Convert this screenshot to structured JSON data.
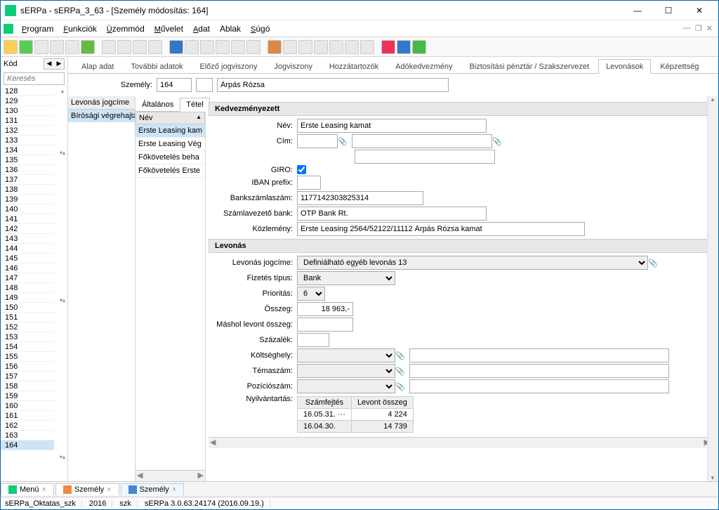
{
  "window": {
    "title": "sERPa - sERPa_3_63 - [Személy módosítás: 164]"
  },
  "menu": {
    "program": "Program",
    "funkciok": "Funkciók",
    "uzemmod": "Üzemmód",
    "muvelet": "Művelet",
    "adat": "Adat",
    "ablak": "Ablak",
    "sugo": "Súgó"
  },
  "sidebar": {
    "kod_label": "Kód",
    "search_ph": "Keresés",
    "rows": [
      "128",
      "129",
      "130",
      "131",
      "132",
      "133",
      "134",
      "135",
      "136",
      "137",
      "138",
      "139",
      "140",
      "141",
      "142",
      "143",
      "144",
      "145",
      "146",
      "147",
      "148",
      "149",
      "150",
      "151",
      "152",
      "153",
      "154",
      "155",
      "156",
      "157",
      "158",
      "159",
      "160",
      "161",
      "162",
      "163",
      "164"
    ],
    "selected": "164"
  },
  "tabs": {
    "items": [
      "Alap adat",
      "További adatok",
      "Előző jogviszony",
      "Jogviszony",
      "Hozzátartozók",
      "Adókedvezmény",
      "Biztosítási pénztár / Szakszervezet",
      "Levonások",
      "Képzettség"
    ],
    "active": 7
  },
  "person_row": {
    "label": "Személy:",
    "code": "164",
    "name": "Árpás Rózsa"
  },
  "narrow": {
    "head": "Levonás jogcíme",
    "cell": "Bírósági végrehajtás"
  },
  "mid": {
    "tabs": [
      "Általános",
      "Tétel"
    ],
    "active": 1,
    "head": "Név",
    "rows": [
      "Erste Leasing kam",
      "Erste Leasing Vég",
      "Főkövetelés beha",
      "Főkövetelés Erste"
    ],
    "selected": 0
  },
  "form": {
    "group1": "Kedvezményezett",
    "nev_lbl": "Név:",
    "nev_val": "Erste Leasing kamat",
    "cim_lbl": "Cím:",
    "giro_lbl": "GIRO:",
    "giro_checked": true,
    "iban_lbl": "IBAN prefix:",
    "bank_lbl": "Bankszámlaszám:",
    "bank_val": "1177142303825314",
    "szaml_lbl": "Számlavezető bank:",
    "szaml_val": "OTP Bank Rt.",
    "kozl_lbl": "Közlemény:",
    "kozl_val": "Erste Leasing 2564/52122/11112 Árpás Rózsa kamat",
    "group2": "Levonás",
    "jogc_lbl": "Levonás jogcíme:",
    "jogc_val": "Definiálható egyéb levonás 13",
    "fiz_lbl": "Fizetés típus:",
    "fiz_val": "Bank",
    "prio_lbl": "Prioritás:",
    "prio_val": "6",
    "ossz_lbl": "Összeg:",
    "ossz_val": "18 963,-",
    "mashol_lbl": "Máshol levont összeg:",
    "szaz_lbl": "Százalék:",
    "kolt_lbl": "Költséghely:",
    "tema_lbl": "Témaszám:",
    "poz_lbl": "Pozíciószám:",
    "nyilv_lbl": "Nyilvántartás:",
    "tbl_h1": "Számfejtés",
    "tbl_h2": "Levont összeg",
    "tbl_r1c1": "16.05.31.",
    "tbl_r1c1b": "···",
    "tbl_r1c2": "4 224",
    "tbl_r2c1": "16.04.30.",
    "tbl_r2c2": "14 739"
  },
  "bottom": {
    "t1": "Menü",
    "t2": "Személy",
    "t3": "Személy"
  },
  "status": {
    "s1": "sERPa_Oktatas_szk",
    "s2": "2016",
    "s3": "szk",
    "s4": "sERPa 3.0.63.24174 (2016.09.19.)"
  }
}
